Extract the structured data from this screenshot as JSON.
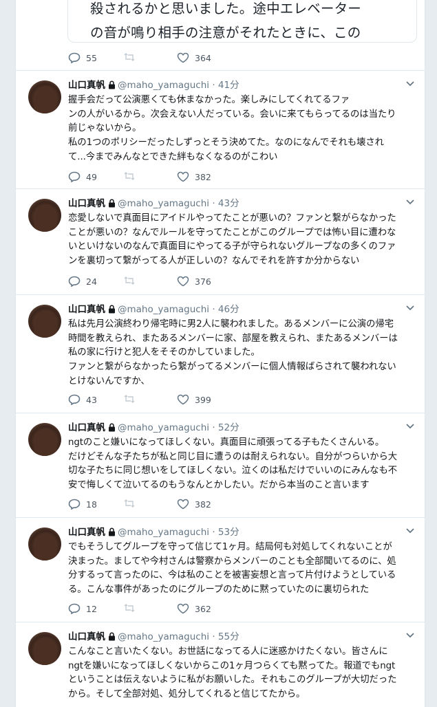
{
  "previous_tweet": {
    "quote_lines": [
      "殺されるかと思いました。途中エレベーター",
      "の音が鳴り相手の注意がそれたときに、この"
    ],
    "reply_count": "55",
    "like_count": "364"
  },
  "tweets": [
    {
      "name": "山口真帆",
      "handle": "@maho_yamaguchi",
      "dot": "·",
      "time": "41分",
      "lines": [
        "握手会だって公演悪くても休まなかった。楽しみにしてくれてるファ",
        "ンの人がいるから。次会えない人だっている。会いに来てもらってるのは当たり",
        "前じゃないから。",
        "私の1つのポリシーだったしずっとそう決めてた。なのになんでそれも壊され",
        "て...今までみんなとできた絆もなくなるのがこわい"
      ],
      "reply_count": "49",
      "like_count": "382"
    },
    {
      "name": "山口真帆",
      "handle": "@maho_yamaguchi",
      "dot": "·",
      "time": "43分",
      "lines": [
        "恋愛しないで真面目にアイドルやってたことが悪いの？ファンと繋がらなかった",
        "ことが悪いの？なんでルールを守ってたことがこのグループでは怖い目に遭わな",
        "いといけないのなんで真面目にやってる子が守られないグループなの多くのファ",
        "ンを裏切って繋がってる人が正しいの？なんでそれを許すか分からない"
      ],
      "reply_count": "24",
      "like_count": "376"
    },
    {
      "name": "山口真帆",
      "handle": "@maho_yamaguchi",
      "dot": "·",
      "time": "46分",
      "lines": [
        "私は先月公演終わり帰宅時に男2人に襲われました。あるメンバーに公演の帰宅",
        "時間を教えられ、またあるメンバーに家、部屋を教えられ、またあるメンバーは",
        "私の家に行けと犯人をそそのかしていました。",
        "ファンと繋がらなかったら繋がってるメンバーに個人情報ばらされて襲われない",
        "とけないんですか、"
      ],
      "reply_count": "43",
      "like_count": "399"
    },
    {
      "name": "山口真帆",
      "handle": "@maho_yamaguchi",
      "dot": "·",
      "time": "52分",
      "lines": [
        "ngtのこと嫌いになってほしくない。真面目に頑張ってる子もたくさんいる。",
        "だけどそんな子たちが私と同じ目に遭うのは耐えられない。自分がつらいから大",
        "切な子たちに同じ想いをしてほしくない。泣くのは私だけでいいのにみんなも不",
        "安で悔しくて泣いてるのもうなんとかしたい。だから本当のこと言います"
      ],
      "reply_count": "18",
      "like_count": "382"
    },
    {
      "name": "山口真帆",
      "handle": "@maho_yamaguchi",
      "dot": "·",
      "time": "53分",
      "lines": [
        "でもそうしてグループを守って信じて1ヶ月。結局何も対処してくれないことが",
        "決まった。ましてや今村さんは警察からメンバーのことも全部聞いてるのに、処",
        "分するって言ったのに、今は私のことを被害妄想と言って片付けようとしている",
        "る。こんな事件があったのにグループのために黙っていたのに裏切られた"
      ],
      "reply_count": "12",
      "like_count": "362"
    },
    {
      "name": "山口真帆",
      "handle": "@maho_yamaguchi",
      "dot": "·",
      "time": "55分",
      "lines": [
        "こんなこと言いたくない。お世話になってる人に迷惑かけたくない。皆さんに",
        "ngtを嫌いになってほしくないからこの1ヶ月つらくても黙ってた。報道でもngt",
        "ということは伝えないように私がお願いした。それもこのグループが大切だった",
        "から。そして全部対処、処分してくれると信じてたから。"
      ],
      "reply_count": "",
      "like_count": ""
    }
  ]
}
